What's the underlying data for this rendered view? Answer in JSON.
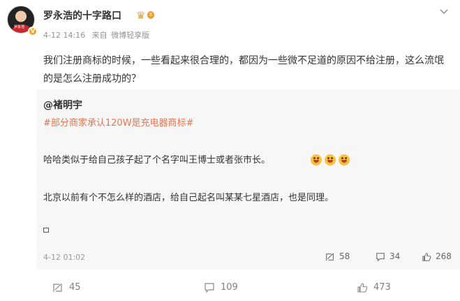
{
  "user": {
    "name": "罗永浩的十字路口",
    "level_badge": "II",
    "verified_badge": "V",
    "avatar_caption": "罗永浩"
  },
  "meta": {
    "time": "4-12 14:16",
    "source_prefix": "来自",
    "source": "微博轻享版"
  },
  "post": {
    "text": "我们注册商标的时候，一些看起来很合理的，都因为一些微不足道的原因不给注册，这么流氓的是怎么注册成功的？"
  },
  "repost": {
    "user": "@褚明宇",
    "topic": "#部分商家承认120W是充电器商标#",
    "line1": "哈哈类似于给自己孩子起了个名字叫王博士或者张市长。",
    "line2": "北京以前有个不怎么样的酒店，给自己起名叫某某七星酒店，也是同理。",
    "time": "4-12 01:02",
    "reposts": "58",
    "comments": "34",
    "likes": "268"
  },
  "actions": {
    "reposts": "45",
    "comments": "109",
    "likes": "473"
  },
  "icons": [
    "more-icon",
    "repost-icon",
    "comment-icon",
    "like-icon",
    "emoji-laugh-icon",
    "image-icon"
  ],
  "colors": {
    "topic": "#eb7350",
    "repost_bg": "#f7f7f7",
    "level_badge": "#e8a034",
    "verified": "#f6a623"
  }
}
